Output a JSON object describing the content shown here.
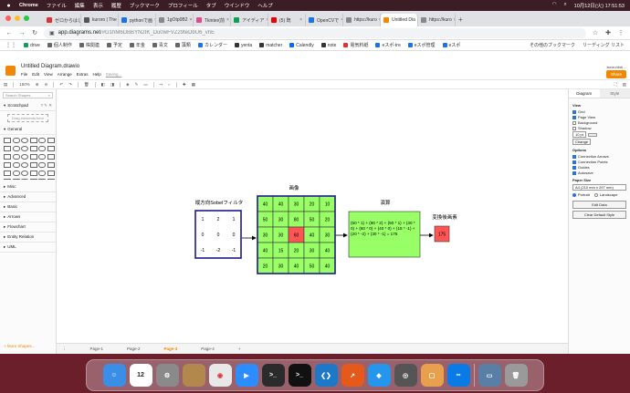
{
  "menubar": {
    "app": "Chrome",
    "items": [
      "ファイル",
      "編集",
      "表示",
      "履歴",
      "ブックマーク",
      "プロフィール",
      "タブ",
      "ウインドウ",
      "ヘルプ"
    ],
    "datetime": "10月12日(火)  17:51:53"
  },
  "tabs": [
    {
      "label": "ゼロからはじ",
      "color": "#d33"
    },
    {
      "label": "kuroro | The",
      "color": "#555"
    },
    {
      "label": "pythonで画",
      "color": "#1a73e8"
    },
    {
      "label": "1gOtp0B2",
      "color": "#888"
    },
    {
      "label": "Tkinter(前",
      "color": "#e04b8f"
    },
    {
      "label": "アイディア",
      "color": "#0f9d58"
    },
    {
      "label": "(5) 既",
      "color": "#e00"
    },
    {
      "label": "OpenCVで",
      "color": "#1a73e8"
    },
    {
      "label": "https://kuro",
      "color": "#888"
    },
    {
      "label": "Untitled Dia",
      "color": "#f08705",
      "active": true
    },
    {
      "label": "https://kuro",
      "color": "#888"
    }
  ],
  "address": {
    "host": "app.diagrams.net",
    "path": "/#G1hM6DBBYN2IK_Du0wFVZ29teDbU6_vnE"
  },
  "bookmarks": [
    {
      "label": "drive",
      "color": "#0f9d58"
    },
    {
      "label": "個人制作",
      "color": "#666"
    },
    {
      "label": "株関連",
      "color": "#666"
    },
    {
      "label": "予定",
      "color": "#666"
    },
    {
      "label": "年金",
      "color": "#666"
    },
    {
      "label": "青文",
      "color": "#666"
    },
    {
      "label": "藻類",
      "color": "#666"
    },
    {
      "label": "カレンダー",
      "color": "#1a73e8"
    },
    {
      "label": "yenta",
      "color": "#333"
    },
    {
      "label": "matcher",
      "color": "#333"
    },
    {
      "label": "Calendly",
      "color": "#006bff"
    },
    {
      "label": "note",
      "color": "#333"
    },
    {
      "label": "電気料紙",
      "color": "#d33"
    },
    {
      "label": "eスポ-tre",
      "color": "#1a73e8"
    },
    {
      "label": "eスポ管理",
      "color": "#1a73e8"
    },
    {
      "label": "eスポ",
      "color": "#1a73e8"
    }
  ],
  "bookmarks_right": [
    "その他のブックマーク",
    "リーディング リスト"
  ],
  "drawio": {
    "title": "Untitled Diagram.drawio",
    "menus": [
      "File",
      "Edit",
      "View",
      "Arrange",
      "Extras",
      "Help"
    ],
    "saving": "Saving...",
    "user": "kuroro.blob ...",
    "share": "Share",
    "zoom": "150%",
    "search_placeholder": "Search Shapes",
    "scratchpad": "Scratchpad",
    "drag_hint": "Drag elements here",
    "general": "General",
    "sections": [
      "Misc",
      "Advanced",
      "Basic",
      "Arrows",
      "Flowchart",
      "Entity Relation",
      "UML"
    ],
    "more_shapes": "+ More Shapes...",
    "pages": [
      "Page-1",
      "Page-2",
      "Page-3",
      "Page-4"
    ],
    "current_page": "Page-3"
  },
  "right_panel": {
    "tabs": [
      "Diagram",
      "Style"
    ],
    "view": "View",
    "options_view": [
      {
        "label": "Grid",
        "on": true
      },
      {
        "label": "Page View",
        "on": true
      },
      {
        "label": "Background",
        "on": false
      },
      {
        "label": "Shadow",
        "on": false
      }
    ],
    "grid_size": "10 pt",
    "change": "Change",
    "options": "Options",
    "options_list": [
      {
        "label": "Connection Arrows",
        "on": true
      },
      {
        "label": "Connection Points",
        "on": true
      },
      {
        "label": "Guides",
        "on": true
      },
      {
        "label": "Autosave",
        "on": true
      }
    ],
    "paper_size": "Paper Size",
    "paper_value": "A4 (210 mm x 297 mm)",
    "portrait": "Portrait",
    "landscape": "Landscape",
    "edit_data": "Edit Data",
    "clear_style": "Clear Default Style"
  },
  "diagram": {
    "kernel_label": "縦方向Sobelフィルタ",
    "kernel": [
      [
        "1",
        "2",
        "1"
      ],
      [
        "0",
        "0",
        "0"
      ],
      [
        "-1",
        "-2",
        "-1"
      ]
    ],
    "image_label": "画像",
    "image": [
      [
        "40",
        "40",
        "30",
        "20",
        "10"
      ],
      [
        "50",
        "30",
        "80",
        "50",
        "20"
      ],
      [
        "30",
        "30",
        "60",
        "40",
        "30"
      ],
      [
        "40",
        "15",
        "20",
        "30",
        "40"
      ],
      [
        "20",
        "30",
        "40",
        "50",
        "40"
      ]
    ],
    "calc_label": "演算",
    "calc_text": "(50 * 1) + (80 * 2) + (50 * 1) + (30 * 0) + (60 * 0) + (40 * 0) + (15 * -1) + (20 * -2) + (30 * -1) = 175",
    "result_label": "変換後画素",
    "result": "175",
    "colors": {
      "grid_fill": "#99ff66",
      "highlight": "#ff5555",
      "border": "#1a1a8c"
    }
  },
  "dock": [
    {
      "name": "finder",
      "color": "#3a8ee6",
      "glyph": "☺"
    },
    {
      "name": "calendar",
      "color": "#ffffff",
      "glyph": "12"
    },
    {
      "name": "system-prefs",
      "color": "#8a8a8a",
      "glyph": "⚙"
    },
    {
      "name": "notes-app",
      "color": "#b3884d",
      "glyph": ""
    },
    {
      "name": "chrome",
      "color": "#e8e8e8",
      "glyph": "◉"
    },
    {
      "name": "zoom",
      "color": "#2d8cff",
      "glyph": "▶"
    },
    {
      "name": "terminal-1",
      "color": "#2b2b2b",
      "glyph": ">_"
    },
    {
      "name": "terminal-2",
      "color": "#111111",
      "glyph": ">_"
    },
    {
      "name": "vscode",
      "color": "#1e78c8",
      "glyph": "❮❯"
    },
    {
      "name": "chart-app",
      "color": "#e55a1a",
      "glyph": "↗"
    },
    {
      "name": "docker",
      "color": "#2496ed",
      "glyph": "◆"
    },
    {
      "name": "camera-app",
      "color": "#555555",
      "glyph": "◎"
    },
    {
      "name": "photo-app",
      "color": "#e9a04d",
      "glyph": "▢"
    },
    {
      "name": "link-app",
      "color": "#0a7be6",
      "glyph": "∞"
    },
    {
      "name": "preview",
      "color": "#5a7fa6",
      "glyph": "▭"
    },
    {
      "name": "trash",
      "color": "#9a9a9a",
      "glyph": "🗑"
    }
  ]
}
